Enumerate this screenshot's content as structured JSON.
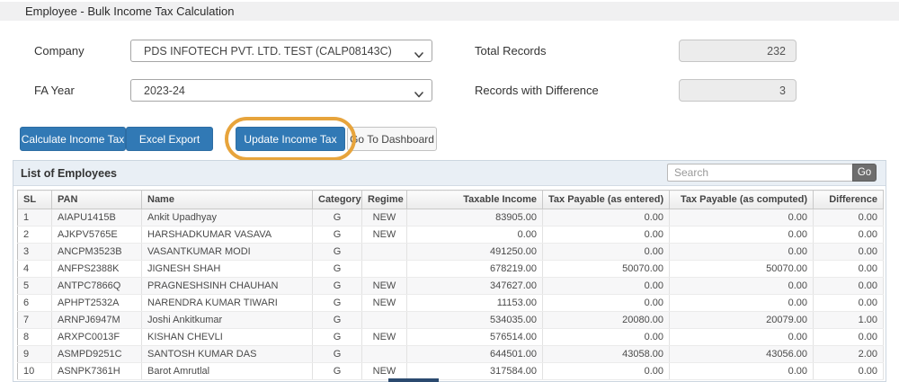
{
  "header": {
    "title": "Employee - Bulk Income Tax Calculation"
  },
  "form": {
    "company": {
      "label": "Company",
      "value": "PDS INFOTECH PVT. LTD. TEST (CALP08143C)"
    },
    "fa_year": {
      "label": "FA Year",
      "value": "2023-24"
    },
    "total_records": {
      "label": "Total Records",
      "value": "232"
    },
    "records_with_difference": {
      "label": "Records with Difference",
      "value": "3"
    }
  },
  "toolbar": {
    "calculate_label": "Calculate Income Tax",
    "excel_export_label": "Excel Export",
    "update_label": "Update Income Tax",
    "dashboard_label": "Go To Dashboard"
  },
  "panel": {
    "title": "List of Employees",
    "search_placeholder": "Search",
    "go_label": "Go"
  },
  "table": {
    "columns": [
      "SL",
      "PAN",
      "Name",
      "Category",
      "Regime",
      "Taxable Income",
      "Tax Payable (as entered)",
      "Tax Payable (as computed)",
      "Difference"
    ],
    "rows": [
      [
        "1",
        "AIAPU1415B",
        "Ankit Upadhyay",
        "G",
        "NEW",
        "83905.00",
        "0.00",
        "0.00",
        "0.00"
      ],
      [
        "2",
        "AJKPV5765E",
        "HARSHADKUMAR VASAVA",
        "G",
        "NEW",
        "0.00",
        "0.00",
        "0.00",
        "0.00"
      ],
      [
        "3",
        "ANCPM3523B",
        "VASANTKUMAR MODI",
        "G",
        "",
        "491250.00",
        "0.00",
        "0.00",
        "0.00"
      ],
      [
        "4",
        "ANFPS2388K",
        "JIGNESH SHAH",
        "G",
        "",
        "678219.00",
        "50070.00",
        "50070.00",
        "0.00"
      ],
      [
        "5",
        "ANTPC7866Q",
        "PRAGNESHSINH CHAUHAN",
        "G",
        "NEW",
        "347627.00",
        "0.00",
        "0.00",
        "0.00"
      ],
      [
        "6",
        "APHPT2532A",
        "NARENDRA KUMAR TIWARI",
        "G",
        "NEW",
        "11153.00",
        "0.00",
        "0.00",
        "0.00"
      ],
      [
        "7",
        "ARNPJ6947M",
        "Joshi Ankitkumar",
        "G",
        "",
        "534035.00",
        "20080.00",
        "20079.00",
        "1.00"
      ],
      [
        "8",
        "ARXPC0013F",
        "KISHAN CHEVLI",
        "G",
        "NEW",
        "576514.00",
        "0.00",
        "0.00",
        "0.00"
      ],
      [
        "9",
        "ASMPD9251C",
        "SANTOSH KUMAR DAS",
        "G",
        "",
        "644501.00",
        "43058.00",
        "43056.00",
        "2.00"
      ],
      [
        "10",
        "ASNPK7361H",
        "Barot Amrutlal",
        "G",
        "NEW",
        "317584.00",
        "0.00",
        "0.00",
        "0.00"
      ]
    ]
  },
  "colors": {
    "primary_button": "#3179b5",
    "highlight_annotation": "#e7a43c",
    "go_button": "#6e6e6e",
    "panel_header_bg": "#e9eff5",
    "topbar_bg": "#f0f0f1",
    "readonly_input_bg": "#ececec"
  }
}
